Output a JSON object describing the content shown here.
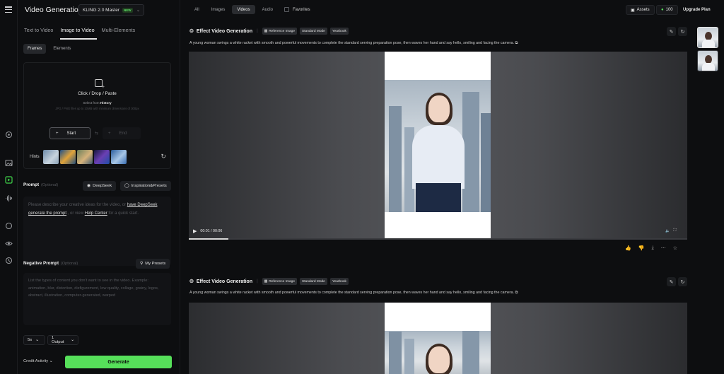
{
  "app": {
    "title": "Video Generation",
    "model": "KLING 2.0 Master",
    "model_badge": "NEW"
  },
  "modes": [
    "Text to Video",
    "Image to Video",
    "Multi-Elements"
  ],
  "active_mode": "Image to Video",
  "subtabs": [
    "Frames",
    "Elements"
  ],
  "upload": {
    "title": "Click / Drop / Paste",
    "select_prefix": "Select from",
    "select_link": "History",
    "hint": "JPG / PNG files up to 10MB with minimum dimensions of 300px",
    "start": "Start",
    "end": "End"
  },
  "hints_label": "Hints",
  "prompt": {
    "label": "Prompt",
    "optional": "(Optional)",
    "deepseek": "DeepSeek",
    "inspiration": "Inspiration&Presets",
    "placeholder_1": "Please describe your creative ideas for the video, or",
    "link_1": "have DeepSeek",
    "link_2": "generate the prompt",
    "placeholder_2": ", or view",
    "link_3": "Help Center",
    "placeholder_3": "for a quick start."
  },
  "negative": {
    "label": "Negative Prompt",
    "optional": "(Optional)",
    "presets": "My Presets",
    "placeholder": "List the types of content you don't want to see in the video. Example: animation, blur, distortion, disfigurement, low quality, collage, grainy, logos, abstract, illustration, computer-generated, warped"
  },
  "settings": {
    "duration": "5s",
    "outputs": "1 Output"
  },
  "credit": "Credit Activity",
  "generate": "Generate",
  "filters": [
    "All",
    "Images",
    "Videos",
    "Audio"
  ],
  "active_filter": "Videos",
  "favorites": "Favorites",
  "assets": "Assets",
  "credits": "100",
  "upgrade": "Upgrade Plan",
  "cards": [
    {
      "title": "Effect Video Generation",
      "tags": [
        "Reference Image",
        "Standard Mode",
        "Yearbook"
      ],
      "desc": "A young woman swings a white racket with smooth and powerful movements to complete the standard serving preparation pose, then waves her hand and say hello, smiling and facing the camera.",
      "time": "00:01 / 00:06",
      "progress": 0.08
    },
    {
      "title": "Effect Video Generation",
      "tags": [
        "Reference Image",
        "Standard Mode",
        "Yearbook"
      ],
      "desc": "A young woman swings a white racket with smooth and powerful movements to complete the standard serving preparation pose, then waves her hand and say hello, smiling and facing the camera."
    }
  ],
  "colors": {
    "accent": "#56e05a",
    "background": "#0d0e10"
  }
}
